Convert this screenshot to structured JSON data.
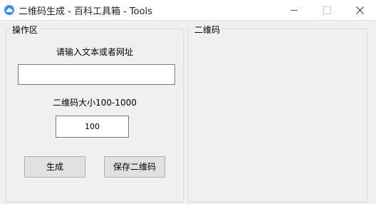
{
  "window": {
    "title": "二维码生成 - 百科工具箱 - Tools",
    "icon": "cloud-icon",
    "controls": [
      "minimize-icon",
      "maximize-icon",
      "close-icon"
    ]
  },
  "operation_panel": {
    "title": "操作区",
    "url_label": "请输入文本或者网址",
    "url_value": "",
    "size_label": "二维码大小100-1000",
    "size_value": "100",
    "generate_button": "生成",
    "save_button": "保存二维码"
  },
  "qr_panel": {
    "title": "二维码"
  }
}
